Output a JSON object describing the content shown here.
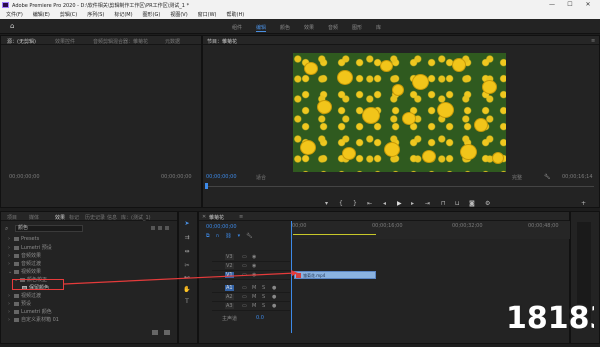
{
  "window": {
    "title": "Adobe Premiere Pro 2020 - D:\\软件相关\\剪辑制作工作区\\PR工作区\\测试_1 *",
    "minimize": "—",
    "maximize": "☐",
    "close": "✕"
  },
  "menu": [
    "文件(F)",
    "编辑(E)",
    "剪辑(C)",
    "序列(S)",
    "标记(M)",
    "图形(G)",
    "视图(V)",
    "窗口(W)",
    "帮助(H)"
  ],
  "workspaces": [
    "组件",
    "编辑",
    "颜色",
    "效果",
    "音频",
    "图形",
    "库"
  ],
  "source_panel": {
    "tabs": [
      "源：(无剪辑)",
      "效果控件",
      "音频剪辑混合器：雏菊花",
      "元数据"
    ],
    "timecode_left": "00;00;00;00",
    "timecode_right": "00;00;00;00"
  },
  "program_panel": {
    "tab": "节目：雏菊花",
    "timecode": "00;00;00;00",
    "fit": "适合",
    "quality": "完整",
    "duration": "00;00;16;14"
  },
  "effects_panel": {
    "tabs": [
      "项目",
      "媒体",
      "效果",
      "标记",
      "历史记录",
      "信息",
      "库：(测试_1)"
    ],
    "search_value": "颜色",
    "items": [
      {
        "label": "Presets",
        "level": 0
      },
      {
        "label": "Lumetri 预设",
        "level": 0
      },
      {
        "label": "音频效果",
        "level": 0
      },
      {
        "label": "音频过渡",
        "level": 0
      },
      {
        "label": "视频效果",
        "level": 0
      },
      {
        "label": "颜色校正",
        "level": 1
      },
      {
        "label": "保留颜色",
        "level": 2
      },
      {
        "label": "视频过渡",
        "level": 0
      },
      {
        "label": "预设",
        "level": 0
      },
      {
        "label": "Lumetri 颜色",
        "level": 0
      },
      {
        "label": "自定义素材箱 01",
        "level": 0
      }
    ]
  },
  "timeline": {
    "tab": "雏菊花",
    "timecode": "00;00;00;00",
    "ruler": [
      "00;00",
      "00;00;16;00",
      "00;00;32;00",
      "00;00;48;00"
    ],
    "tracks": [
      "V3",
      "V2",
      "V1",
      "A1",
      "A2",
      "A3"
    ],
    "master": "主声道",
    "master_value": "0.0",
    "clip_name": "雏菊花.mp4"
  },
  "watermark": "18183",
  "colors": {
    "accent": "#4a8fe0",
    "annotation": "#e53b3b",
    "clip": "#8ab2e0"
  }
}
